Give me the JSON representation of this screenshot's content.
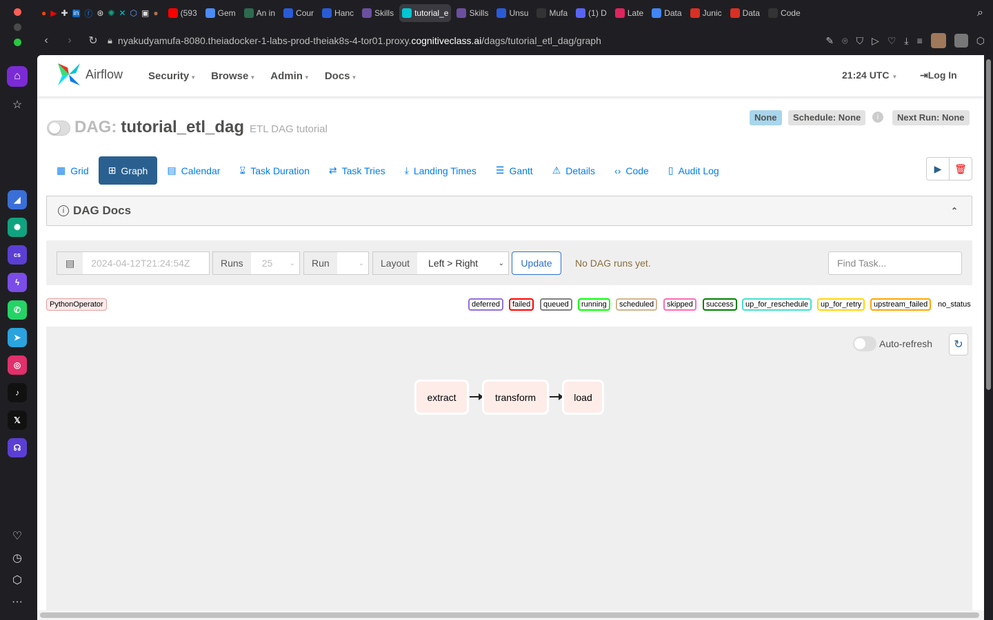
{
  "browser": {
    "tabs": [
      {
        "label": "(593",
        "color": "#ff0000"
      },
      {
        "label": "Gem",
        "color": "#4b8bf5"
      },
      {
        "label": "An in",
        "color": "#2d6a4f"
      },
      {
        "label": "Cour",
        "color": "#2a5bd7"
      },
      {
        "label": "Hanc",
        "color": "#2a5bd7"
      },
      {
        "label": "Skills",
        "color": "#6b4fa0"
      },
      {
        "label": "tutorial_e",
        "color": "#00c7d4"
      },
      {
        "label": "Skills",
        "color": "#6b4fa0"
      },
      {
        "label": "Unsu",
        "color": "#2a5bd7"
      },
      {
        "label": "Mufa",
        "color": "#333333"
      },
      {
        "label": "(1) D",
        "color": "#5865f2"
      },
      {
        "label": "Late",
        "color": "#e0245e"
      },
      {
        "label": "Data",
        "color": "#4285f4"
      },
      {
        "label": "Junic",
        "color": "#d93025"
      },
      {
        "label": "Data",
        "color": "#d93025"
      },
      {
        "label": "Code",
        "color": "#333333"
      }
    ],
    "url_prefix": "nyakudyamufa-8080.theiadocker-1-labs-prod-theiak8s-4-tor01.proxy.",
    "url_domain": "cognitiveclass.ai",
    "url_path": "/dags/tutorial_etl_dag/graph"
  },
  "navbar": {
    "logo_text": "Airflow",
    "menu": [
      "Security",
      "Browse",
      "Admin",
      "Docs"
    ],
    "time": "21:24 UTC",
    "login": "Log In"
  },
  "dag": {
    "label": "DAG:",
    "name": "tutorial_etl_dag",
    "description": "ETL DAG tutorial",
    "badge_none": "None",
    "schedule": "Schedule: None",
    "next_run": "Next Run: None"
  },
  "view_tabs": [
    "Grid",
    "Graph",
    "Calendar",
    "Task Duration",
    "Task Tries",
    "Landing Times",
    "Gantt",
    "Details",
    "Code",
    "Audit Log"
  ],
  "docs_title": "DAG Docs",
  "filters": {
    "base_date": "2024-04-12T21:24:54Z",
    "runs_label": "Runs",
    "runs_value": "25",
    "run_label": "Run",
    "layout_label": "Layout",
    "layout_value": "Left > Right",
    "update": "Update",
    "message": "No DAG runs yet.",
    "find_placeholder": "Find Task..."
  },
  "legend": {
    "operator": "PythonOperator",
    "states": [
      {
        "label": "deferred",
        "color": "#9370db"
      },
      {
        "label": "failed",
        "color": "#ff0000"
      },
      {
        "label": "queued",
        "color": "#808080"
      },
      {
        "label": "running",
        "color": "#00ff00"
      },
      {
        "label": "scheduled",
        "color": "#d2b48c"
      },
      {
        "label": "skipped",
        "color": "#ff69b4"
      },
      {
        "label": "success",
        "color": "#008000"
      },
      {
        "label": "up_for_reschedule",
        "color": "#40e0d0"
      },
      {
        "label": "up_for_retry",
        "color": "#ffd700"
      },
      {
        "label": "upstream_failed",
        "color": "#ffa500"
      }
    ],
    "no_status": "no_status"
  },
  "graph": {
    "auto_refresh": "Auto-refresh",
    "nodes": [
      "extract",
      "transform",
      "load"
    ]
  }
}
